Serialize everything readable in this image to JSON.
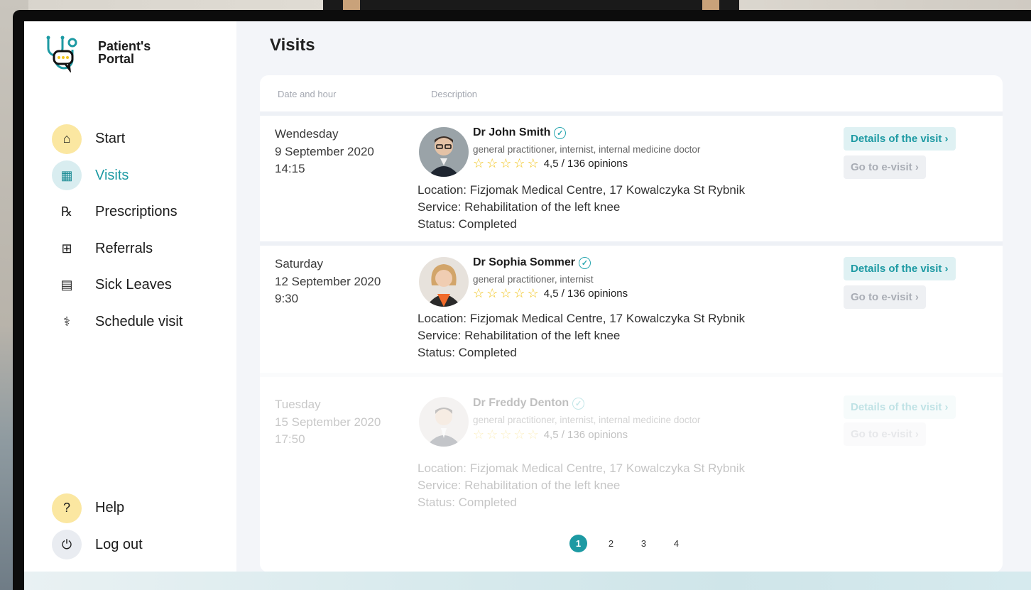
{
  "app": {
    "title_line1": "Patient's",
    "title_line2": "Portal"
  },
  "page": {
    "title": "Visits"
  },
  "colors": {
    "accent": "#1d9aa3",
    "star": "#f2c51e",
    "nav_highlight": "#fbe7a1"
  },
  "nav": [
    {
      "label": "Start",
      "icon": "home-icon",
      "glyph": "⌂"
    },
    {
      "label": "Visits",
      "icon": "calendar-icon",
      "glyph": "▦",
      "active": true
    },
    {
      "label": "Prescriptions",
      "icon": "prescription-icon",
      "glyph": "℞"
    },
    {
      "label": "Referrals",
      "icon": "referral-icon",
      "glyph": "⊞"
    },
    {
      "label": "Sick Leaves",
      "icon": "document-icon",
      "glyph": "▤"
    },
    {
      "label": "Schedule visit",
      "icon": "stethoscope-icon",
      "glyph": "⚕"
    }
  ],
  "nav_bottom": [
    {
      "label": "Help",
      "icon": "help-icon",
      "glyph": "?"
    },
    {
      "label": "Log out",
      "icon": "power-icon",
      "glyph": "⏻"
    }
  ],
  "table": {
    "headers": {
      "date": "Date and hour",
      "description": "Description"
    }
  },
  "visits": [
    {
      "day": "Wendesday",
      "date": "9 September 2020",
      "time": "14:15",
      "doctor": "Dr John Smith",
      "specialty": "general practitioner, internist, internal medicine doctor",
      "rating": "4,5 / 136 opinions",
      "location": "Location: Fizjomak Medical Centre, 17 Kowalczyka St Rybnik",
      "service": "Service: Rehabilitation of the left knee",
      "status": "Status: Completed",
      "details_label": "Details of the visit ›",
      "evisit_label": "Go to e-visit ›"
    },
    {
      "day": "Saturday",
      "date": "12 September 2020",
      "time": "9:30",
      "doctor": "Dr Sophia Sommer",
      "specialty": "general practitioner, internist",
      "rating": "4,5 / 136 opinions",
      "location": "Location: Fizjomak Medical Centre, 17 Kowalczyka St Rybnik",
      "service": "Service: Rehabilitation of the left knee",
      "status": "Status: Completed",
      "details_label": "Details of the visit ›",
      "evisit_label": "Go to e-visit ›"
    },
    {
      "day": "Tuesday",
      "date": "15 September 2020",
      "time": "17:50",
      "doctor": "Dr Freddy Denton",
      "specialty": "general practitioner, internist, internal medicine doctor",
      "rating": "4,5 / 136 opinions",
      "location": "Location: Fizjomak Medical Centre, 17 Kowalczyka St Rybnik",
      "service": "Service: Rehabilitation of the left knee",
      "status": "Status: Completed",
      "details_label": "Details of the visit ›",
      "evisit_label": "Go to e-visit ›"
    }
  ],
  "pagination": {
    "pages": [
      "1",
      "2",
      "3",
      "4"
    ],
    "current": "1"
  }
}
